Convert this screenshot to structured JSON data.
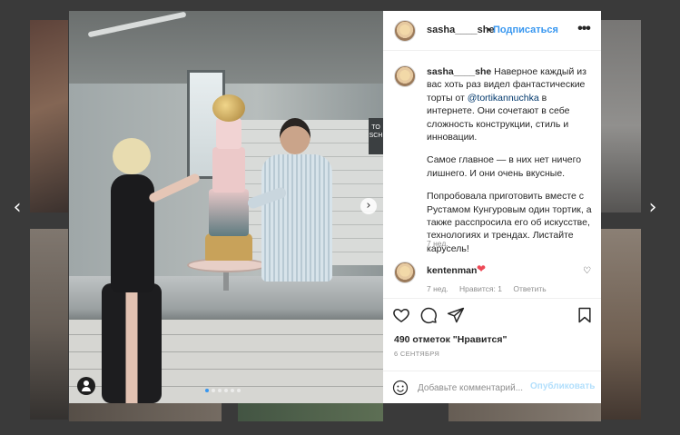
{
  "header": {
    "username": "sasha____she",
    "separator": "•",
    "follow_label": "Подписаться",
    "more_icon": "more-horizontal-icon"
  },
  "caption": {
    "username": "sasha____she",
    "line1": "Наверное каждый из вас хоть раз видел фантастические торты от ",
    "mention": "@tortikannuchka",
    "line1_end": " в интернете. Они сочетают в себе сложность конструкции, стиль и инновации.",
    "para2": "Самое главное — в них нет ничего лишнего. И они очень вкусные.",
    "para3": "Попробовала приготовить вместе с Рустамом Кунгуровым один тортик, а также расспросила его об искусстве, технологиях и трендах. Листайте карусель!",
    "time": "7 нед."
  },
  "comment": {
    "username": "kentenman",
    "text_emoji": "❤",
    "time": "7 нед.",
    "likes": "Нравится: 1",
    "reply": "Ответить"
  },
  "post": {
    "likes_text": "490 отметок \"Нравится\"",
    "date": "6 СЕНТЯБРЯ"
  },
  "add_comment": {
    "placeholder": "Добавьте комментарий...",
    "post_label": "Опубликовать"
  },
  "photo": {
    "sign_text": "TO SCH",
    "carousel_count": 6,
    "carousel_active": 1
  },
  "colors": {
    "accent": "#3897f0",
    "heart": "#ed4956",
    "post_disabled": "#b2dffc",
    "overlay": "#3a3a3a"
  },
  "icons": {
    "prev": "chevron-left-icon",
    "next": "chevron-right-icon",
    "like": "heart-outline-icon",
    "comment": "comment-icon",
    "share": "paper-plane-icon",
    "save": "bookmark-icon",
    "emoji": "smiley-icon",
    "tag": "user-tag-icon"
  },
  "glyphs": {
    "left_arrow": "‹",
    "right_arrow": "›",
    "photo_next": "›",
    "more": "•••",
    "small_heart": "♡"
  }
}
